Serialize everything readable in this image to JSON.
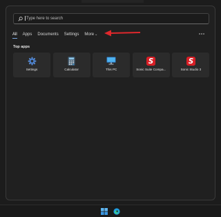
{
  "search": {
    "placeholder": "Type here to search",
    "icon": "search-icon"
  },
  "tabs": [
    {
      "label": "All",
      "active": true
    },
    {
      "label": "Apps"
    },
    {
      "label": "Documents"
    },
    {
      "label": "Settings"
    },
    {
      "label": "More"
    }
  ],
  "more_chevron": "⌄",
  "options_icon": "ellipsis-icon",
  "top_apps": {
    "title": "Top apps",
    "items": [
      {
        "label": "Settings",
        "icon": "gear-icon"
      },
      {
        "label": "Calculator",
        "icon": "calculator-icon"
      },
      {
        "label": "This PC",
        "icon": "monitor-icon"
      },
      {
        "label": "Sonic Suite Compa...",
        "icon": "sonic-icon"
      },
      {
        "label": "Sonic Studio 3",
        "icon": "sonic-icon"
      }
    ]
  },
  "annotation": {
    "arrow_color": "#e0282c"
  },
  "colors": {
    "accent": "#7aa7e0",
    "sonic_red": "#e02020"
  },
  "taskbar": {
    "icons": [
      "windows-start-icon",
      "edge-browser-icon"
    ]
  }
}
